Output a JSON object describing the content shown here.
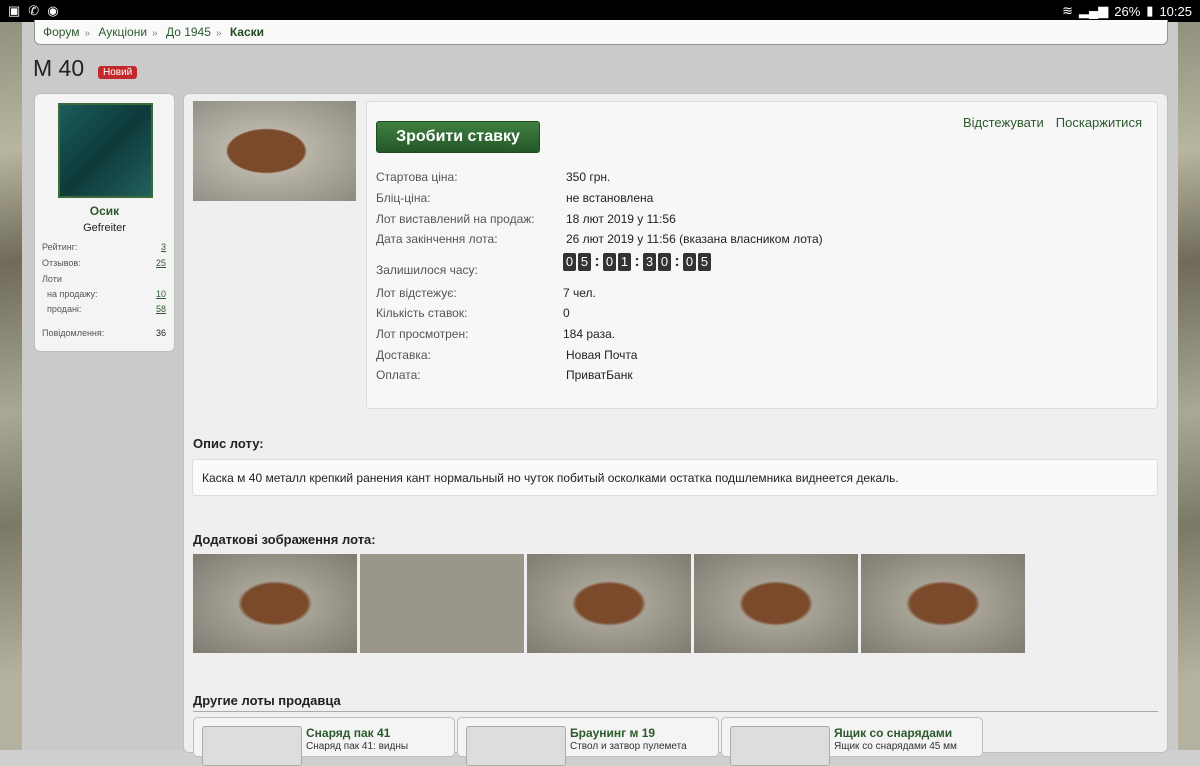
{
  "status": {
    "battery": "26%",
    "time": "10:25"
  },
  "breadcrumb": [
    "Форум",
    "Аукціони",
    "До 1945",
    "Каски"
  ],
  "title": "М 40",
  "badge": "Новий",
  "user": {
    "name": "Осик",
    "rank": "Gefreiter",
    "stats": [
      {
        "label": "Рейтинг:",
        "value": "3"
      },
      {
        "label": "Отзывов:",
        "value": "25"
      },
      {
        "label": "Лоти",
        "value": ""
      },
      {
        "label": "на продажу:",
        "value": "10"
      },
      {
        "label": "продані:",
        "value": "58"
      },
      {
        "label": "Повідомлення:",
        "value": "36"
      }
    ]
  },
  "actions": {
    "bid": "Зробити ставку",
    "watch": "Відстежувати",
    "report": "Поскаржитися"
  },
  "info": [
    {
      "label": "Стартова ціна:",
      "value": "350 грн."
    },
    {
      "label": "Бліц-ціна:",
      "value": "не встановлена"
    },
    {
      "label": "Лот виставлений на продаж:",
      "value": "18 лют 2019 у 11:56"
    },
    {
      "label": "Дата закінчення лота:",
      "value": "26 лют 2019 у 11:56 (вказана власником лота)"
    },
    {
      "label": "Залишилося часу:",
      "value": ""
    },
    {
      "label": "Лот відстежує:",
      "value": "7 чел."
    },
    {
      "label": "Кількість ставок:",
      "value": "0"
    },
    {
      "label": "Лот просмотрен:",
      "value": "184 раза."
    },
    {
      "label": "Доставка:",
      "value": "Новая Почта"
    },
    {
      "label": "Оплата:",
      "value": "ПриватБанк"
    }
  ],
  "timer": [
    "0",
    "5",
    "0",
    "1",
    "3",
    "0",
    "0",
    "5"
  ],
  "description_heading": "Опис лоту:",
  "description": "Каска м 40 металл крепкий ранения кант нормальный но чуток побитый осколками остатка подшлемника виднеется декаль.",
  "images_heading": "Додаткові зображення лота:",
  "other_heading": "Другие лоты продавца",
  "other_lots": [
    {
      "title": "Снаряд пак 41",
      "desc": "Снаряд пак 41: видны"
    },
    {
      "title": "Браунинг м 19",
      "desc": "Ствол и затвор пулемета"
    },
    {
      "title": "Ящик со снарядами",
      "desc": "Ящик со снарядами 45 мм"
    }
  ]
}
